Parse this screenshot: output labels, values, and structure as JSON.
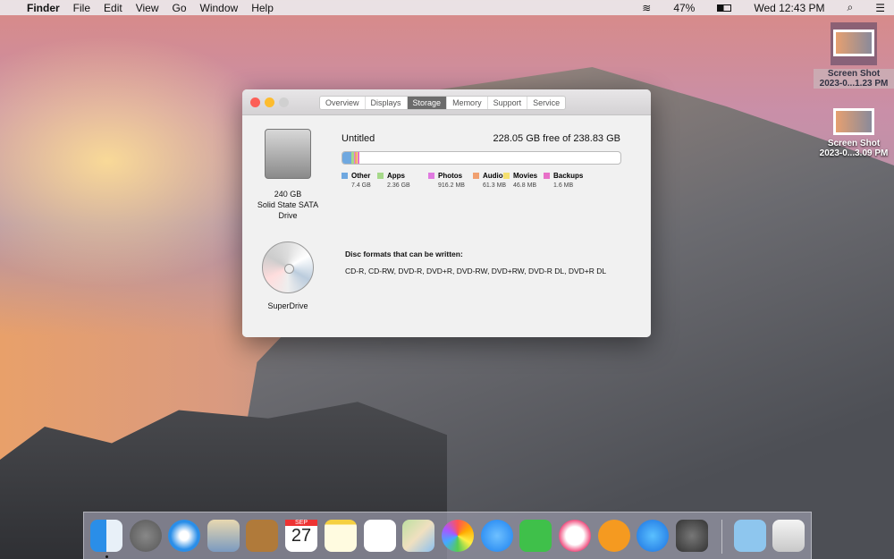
{
  "menubar": {
    "app": "Finder",
    "items": [
      "File",
      "Edit",
      "View",
      "Go",
      "Window",
      "Help"
    ],
    "battery": "47%",
    "clock": "Wed 12:43 PM"
  },
  "window": {
    "tabs": [
      "Overview",
      "Displays",
      "Storage",
      "Memory",
      "Support",
      "Service"
    ],
    "selected_tab": "Storage",
    "drive": {
      "name": "Untitled",
      "free": "228.05 GB free of 238.83 GB",
      "label_size": "240 GB",
      "label_type": "Solid State SATA",
      "label_kind": "Drive",
      "categories": [
        {
          "name": "Other",
          "value": "7.4 GB",
          "color": "#6fa8e0",
          "fraction": 0.031
        },
        {
          "name": "Apps",
          "value": "2.36 GB",
          "color": "#a6d98a",
          "fraction": 0.01
        },
        {
          "name": "Photos",
          "value": "916.2 MB",
          "color": "#e07ae0",
          "fraction": 0.004
        },
        {
          "name": "Audio",
          "value": "61.3 MB",
          "color": "#f0a070",
          "fraction": 0.003
        },
        {
          "name": "Movies",
          "value": "46.8 MB",
          "color": "#f5e070",
          "fraction": 0.002
        },
        {
          "name": "Backups",
          "value": "1.6 MB",
          "color": "#e870c8",
          "fraction": 0.001
        }
      ]
    },
    "superdrive": {
      "label": "SuperDrive",
      "formats_title": "Disc formats that can be written:",
      "formats": "CD-R, CD-RW, DVD-R, DVD+R, DVD-RW, DVD+RW, DVD-R DL, DVD+R DL"
    }
  },
  "desktop": [
    {
      "line1": "Screen Shot",
      "line2": "2023-0...1.23 PM"
    },
    {
      "line1": "Screen Shot",
      "line2": "2023-0...3.09 PM"
    }
  ],
  "dock": {
    "calendar_month": "SEP",
    "calendar_day": "27",
    "apps": [
      "finder",
      "launchpad",
      "safari",
      "mail",
      "contacts",
      "calendar",
      "notes",
      "reminders",
      "maps",
      "photos",
      "messages",
      "facetime",
      "itunes",
      "ibooks",
      "app-store",
      "system-preferences",
      "downloads",
      "trash"
    ]
  }
}
